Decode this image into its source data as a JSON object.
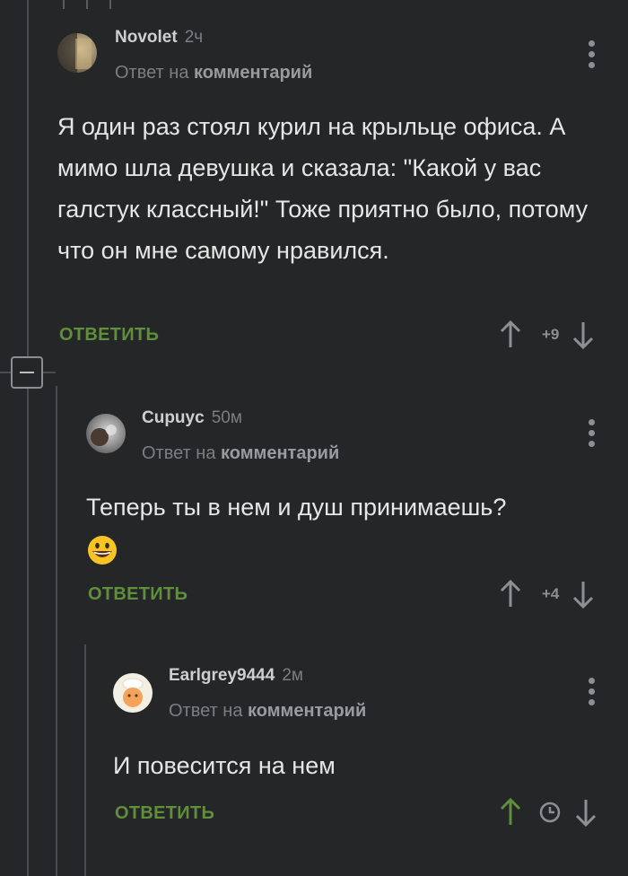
{
  "comments": [
    {
      "author": "Novolet",
      "time": "2ч",
      "reply_prefix": "Ответ на",
      "reply_target": "комментарий",
      "text": "Я один раз стоял курил на крыльце офиса. А мимо шла девушка и сказала: \"Какой у вас галстук классный!\" Тоже приятно было, потому что он мне самому нравился.",
      "reply_label": "ОТВЕТИТЬ",
      "score": "+9"
    },
    {
      "author": "Cupuyc",
      "time": "50м",
      "reply_prefix": "Ответ на",
      "reply_target": "комментарий",
      "text": "Теперь ты в нем и душ принимаешь?",
      "reply_label": "ОТВЕТИТЬ",
      "score": "+4"
    },
    {
      "author": "Earlgrey9444",
      "time": "2м",
      "reply_prefix": "Ответ на",
      "reply_target": "комментарий",
      "text": "И повесится на нем",
      "reply_label": "ОТВЕТИТЬ",
      "score_icon": "clock-icon"
    }
  ],
  "colors": {
    "background": "#252628",
    "accent_green": "#5f8f3a",
    "muted": "#7d7e81"
  }
}
